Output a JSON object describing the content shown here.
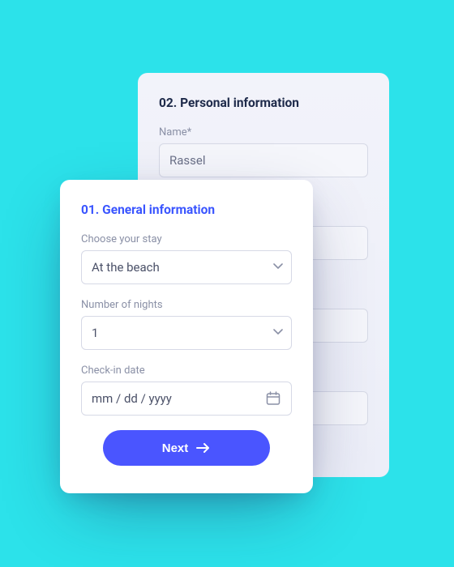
{
  "step2": {
    "title": "02. Personal information",
    "name_label": "Name*",
    "name_value": "Rassel"
  },
  "step1": {
    "title": "01. General information",
    "stay_label": "Choose your stay",
    "stay_value": "At the beach",
    "nights_label": "Number of nights",
    "nights_value": "1",
    "checkin_label": "Check-in date",
    "checkin_placeholder": "mm / dd / yyyy",
    "next_label": "Next"
  }
}
